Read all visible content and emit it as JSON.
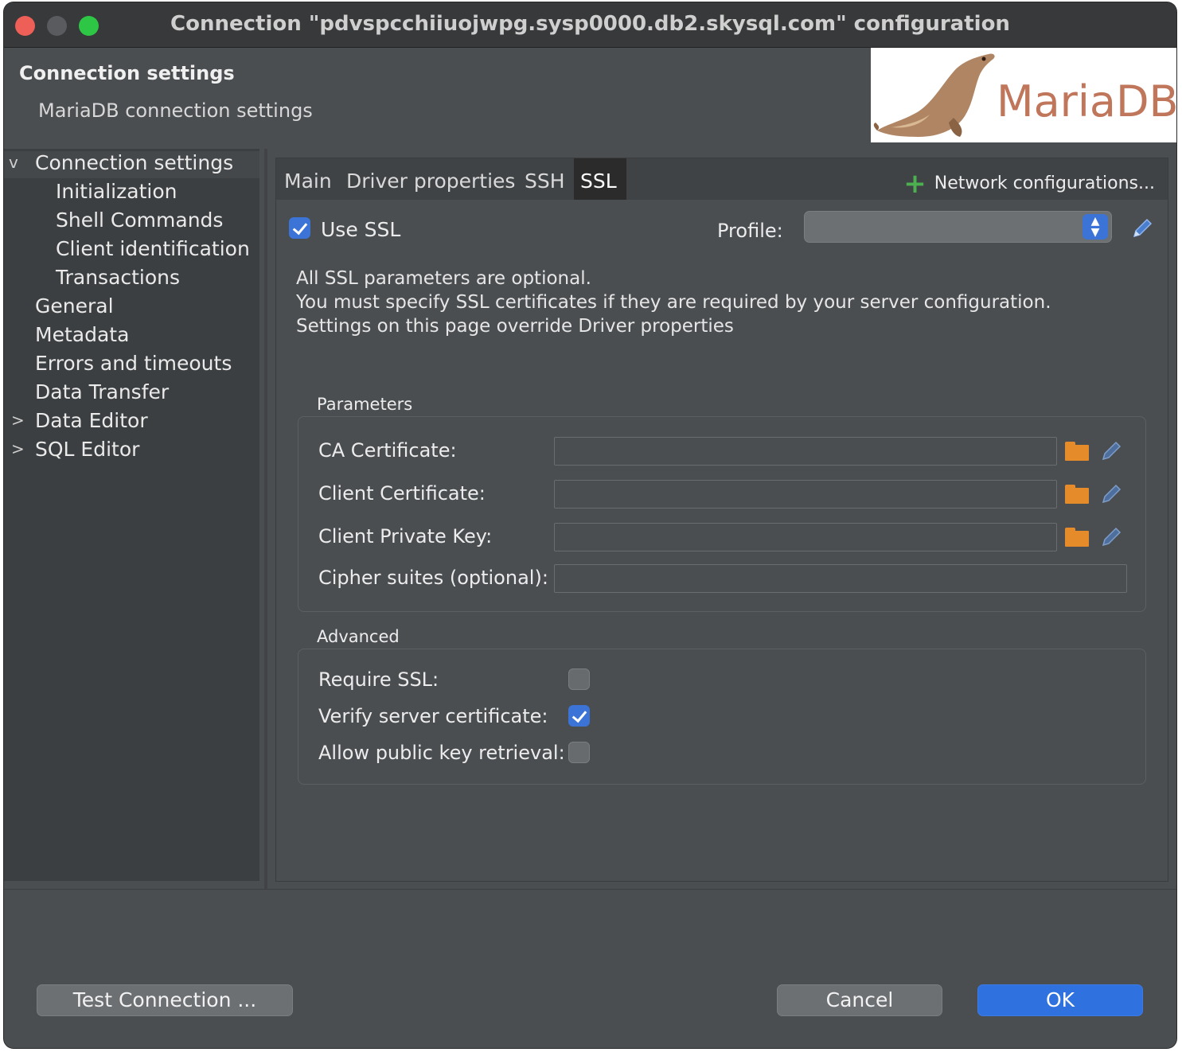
{
  "window": {
    "title": "Connection \"pdvspcchiiuojwpg.sysp0000.db2.skysql.com\" configuration"
  },
  "header": {
    "title": "Connection settings",
    "subtitle": "MariaDB connection settings",
    "logo_text": "MariaDB"
  },
  "sidebar": {
    "items": [
      {
        "label": "Connection settings",
        "arrow": "v"
      },
      {
        "label": "Initialization"
      },
      {
        "label": "Shell Commands"
      },
      {
        "label": "Client identification"
      },
      {
        "label": "Transactions"
      },
      {
        "label": "General"
      },
      {
        "label": "Metadata"
      },
      {
        "label": "Errors and timeouts"
      },
      {
        "label": "Data Transfer"
      },
      {
        "label": "Data Editor",
        "arrow": ">"
      },
      {
        "label": "SQL Editor",
        "arrow": ">"
      }
    ]
  },
  "tabs": {
    "items": [
      "Main",
      "Driver properties",
      "SSH",
      "SSL"
    ],
    "active": "SSL",
    "network_config": "Network configurations..."
  },
  "ssl": {
    "use_ssl_label": "Use SSL",
    "use_ssl_checked": true,
    "profile_label": "Profile:",
    "profile_value": "",
    "info_lines": [
      "All SSL parameters are optional.",
      "You must specify SSL certificates if they are required by your server configuration.",
      "Settings on this page override Driver properties"
    ],
    "parameters": {
      "title": "Parameters",
      "ca_label": "CA Certificate:",
      "ca_value": "",
      "client_cert_label": "Client Certificate:",
      "client_cert_value": "",
      "client_key_label": "Client Private Key:",
      "client_key_value": "",
      "cipher_label": "Cipher suites (optional):",
      "cipher_value": ""
    },
    "advanced": {
      "title": "Advanced",
      "require_ssl_label": "Require SSL:",
      "require_ssl": false,
      "verify_label": "Verify server certificate:",
      "verify": true,
      "allow_pk_label": "Allow public key retrieval:",
      "allow_pk": false
    }
  },
  "footer": {
    "test_label": "Test Connection ...",
    "cancel_label": "Cancel",
    "ok_label": "OK"
  },
  "colors": {
    "accent": "#3b74d6",
    "folder": "#e58b2a",
    "plus": "#4caf50"
  }
}
